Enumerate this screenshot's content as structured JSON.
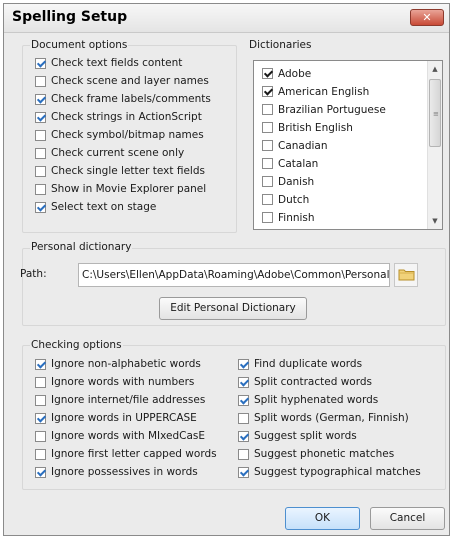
{
  "window": {
    "title": "Spelling Setup",
    "close_glyph": "✕"
  },
  "document_options": {
    "label": "Document options",
    "items": [
      {
        "label": "Check text fields content",
        "checked": true
      },
      {
        "label": "Check scene and layer names",
        "checked": false
      },
      {
        "label": "Check frame labels/comments",
        "checked": true
      },
      {
        "label": "Check strings in ActionScript",
        "checked": true
      },
      {
        "label": "Check symbol/bitmap names",
        "checked": false
      },
      {
        "label": "Check current scene only",
        "checked": false
      },
      {
        "label": "Check single letter text fields",
        "checked": false
      },
      {
        "label": "Show in Movie Explorer panel",
        "checked": false
      },
      {
        "label": "Select text on stage",
        "checked": true
      }
    ]
  },
  "dictionaries": {
    "label": "Dictionaries",
    "items": [
      {
        "label": "Adobe",
        "checked": true
      },
      {
        "label": "American English",
        "checked": true
      },
      {
        "label": "Brazilian Portuguese",
        "checked": false
      },
      {
        "label": "British English",
        "checked": false
      },
      {
        "label": "Canadian",
        "checked": false
      },
      {
        "label": "Catalan",
        "checked": false
      },
      {
        "label": "Danish",
        "checked": false
      },
      {
        "label": "Dutch",
        "checked": false
      },
      {
        "label": "Finnish",
        "checked": false
      }
    ]
  },
  "personal_dictionary": {
    "label": "Personal dictionary",
    "path_label": "Path:",
    "path_value": "C:\\Users\\Ellen\\AppData\\Roaming\\Adobe\\Common\\Personal",
    "edit_button": "Edit Personal Dictionary"
  },
  "checking_options": {
    "label": "Checking options",
    "left": [
      {
        "label": "Ignore non-alphabetic words",
        "checked": true
      },
      {
        "label": "Ignore words with numbers",
        "checked": false
      },
      {
        "label": "Ignore internet/file addresses",
        "checked": false
      },
      {
        "label": "Ignore words in UPPERCASE",
        "checked": true
      },
      {
        "label": "Ignore words with MIxedCasE",
        "checked": false
      },
      {
        "label": "Ignore first letter capped words",
        "checked": false
      },
      {
        "label": "Ignore possessives in words",
        "checked": true
      }
    ],
    "right": [
      {
        "label": "Find duplicate words",
        "checked": true
      },
      {
        "label": "Split contracted words",
        "checked": true
      },
      {
        "label": "Split hyphenated words",
        "checked": true
      },
      {
        "label": "Split words (German, Finnish)",
        "checked": false
      },
      {
        "label": "Suggest split words",
        "checked": true
      },
      {
        "label": "Suggest phonetic matches",
        "checked": false
      },
      {
        "label": "Suggest typographical matches",
        "checked": true
      }
    ]
  },
  "buttons": {
    "ok": "OK",
    "cancel": "Cancel"
  },
  "colors": {
    "accent": "#2a6fbf",
    "close_red": "#c84a36",
    "dialog_bg": "#ebebeb"
  },
  "icons": {
    "folder": "folder-icon",
    "close": "close-icon",
    "scroll_up": "scroll-up-arrow-icon",
    "scroll_down": "scroll-down-arrow-icon"
  }
}
